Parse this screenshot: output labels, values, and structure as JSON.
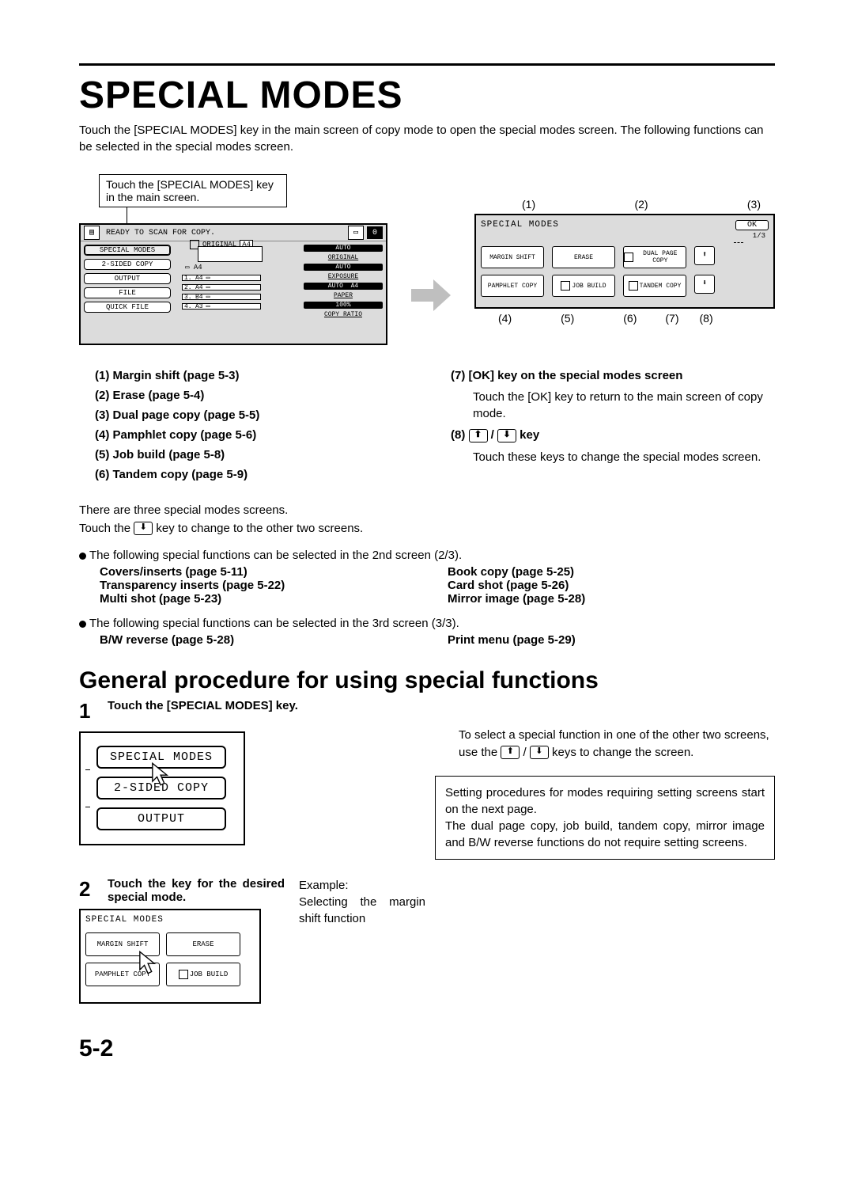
{
  "title": "SPECIAL MODES",
  "intro": "Touch the [SPECIAL MODES] key in the main screen of copy mode to open the special modes screen. The following functions can be selected in the special modes screen.",
  "callout": "Touch the [SPECIAL MODES] key in the main screen.",
  "lcd": {
    "scan_msg": "READY TO SCAN FOR COPY.",
    "count": "0",
    "buttons": {
      "special": "SPECIAL MODES",
      "twosided": "2-SIDED COPY",
      "output": "OUTPUT",
      "file": "FILE",
      "quick": "QUICK FILE"
    },
    "tray_label": "A4",
    "original_label": "ORIGINAL",
    "original_size": "A4",
    "slots": [
      {
        "n": "1.",
        "s": "A4"
      },
      {
        "n": "2.",
        "s": "A4"
      },
      {
        "n": "3.",
        "s": "B4"
      },
      {
        "n": "4.",
        "s": "A3"
      }
    ],
    "right": {
      "auto1": "AUTO",
      "original": "ORIGINAL",
      "auto2": "AUTO",
      "exposure": "EXPOSURE",
      "auto3": "AUTO",
      "paper_size": "A4",
      "paper": "PAPER",
      "ratio_val": "100%",
      "ratio": "COPY RATIO"
    }
  },
  "labels_top": {
    "l1": "(1)",
    "l2": "(2)",
    "l3": "(3)"
  },
  "sp": {
    "title": "SPECIAL MODES",
    "ok": "OK",
    "page": "1/3",
    "cells": {
      "margin": "MARGIN SHIFT",
      "erase": "ERASE",
      "dual": "DUAL PAGE COPY",
      "pamphlet": "PAMPHLET COPY",
      "job": "JOB BUILD",
      "tandem": "TANDEM COPY"
    },
    "up": "⬆",
    "down": "⬇"
  },
  "labels_bottom": {
    "l4": "(4)",
    "l5": "(5)",
    "l6": "(6)",
    "l7": "(7)",
    "l8": "(8)"
  },
  "toc_left": [
    "(1)  Margin shift (page 5-3)",
    "(2)  Erase (page 5-4)",
    "(3)  Dual page copy (page 5-5)",
    "(4)  Pamphlet copy (page 5-6)",
    "(5)  Job build (page 5-8)",
    "(6)  Tandem copy (page 5-9)"
  ],
  "toc_right": {
    "h7": "(7)  [OK] key on the special modes screen",
    "d7": "Touch the [OK] key to return to the main screen of copy mode.",
    "h8a": "(8)  ",
    "h8b": " / ",
    "h8c": "  key",
    "d8": "Touch these keys to change the special modes screen."
  },
  "mid1": "There are three special modes screens.",
  "mid2a": "Touch the ",
  "mid2b": " key to change to the other two screens.",
  "screen2_intro": "The following special functions can be selected in the 2nd screen (2/3).",
  "screen2": {
    "l1": "Covers/inserts (page 5-11)",
    "r1": "Book copy (page 5-25)",
    "l2": "Transparency inserts (page 5-22)",
    "r2": "Card shot (page 5-26)",
    "l3": "Multi shot (page 5-23)",
    "r3": "Mirror image (page 5-28)"
  },
  "screen3_intro": "The following special functions can be selected in the 3rd screen (3/3).",
  "screen3": {
    "l1": "B/W reverse (page 5-28)",
    "r1": "Print menu (page 5-29)"
  },
  "subtitle": "General procedure for using special functions",
  "step1": {
    "num": "1",
    "text": "Touch the [SPECIAL MODES] key.",
    "btns": {
      "special": "SPECIAL MODES",
      "twosided": "2-SIDED COPY",
      "output": "OUTPUT"
    },
    "right_a": "To select a special function in one of the other two screens, use the ",
    "right_b": " / ",
    "right_c": " keys to change the screen."
  },
  "notebox": "Setting procedures for modes requiring setting screens start on the next page.\nThe dual page copy, job build, tandem copy, mirror image and B/W reverse functions do not require setting screens.",
  "step2": {
    "num": "2",
    "text": "Touch the key for the desired special mode.",
    "title": "SPECIAL MODES",
    "cells": {
      "margin": "MARGIN SHIFT",
      "erase": "ERASE",
      "pamphlet": "PAMPHLET COPY",
      "job": "JOB BUILD"
    },
    "example_label": "Example:",
    "example_text": "Selecting the margin shift function"
  },
  "pagenum": "5-2",
  "arrows": {
    "up": "⬆",
    "down": "⬇"
  }
}
